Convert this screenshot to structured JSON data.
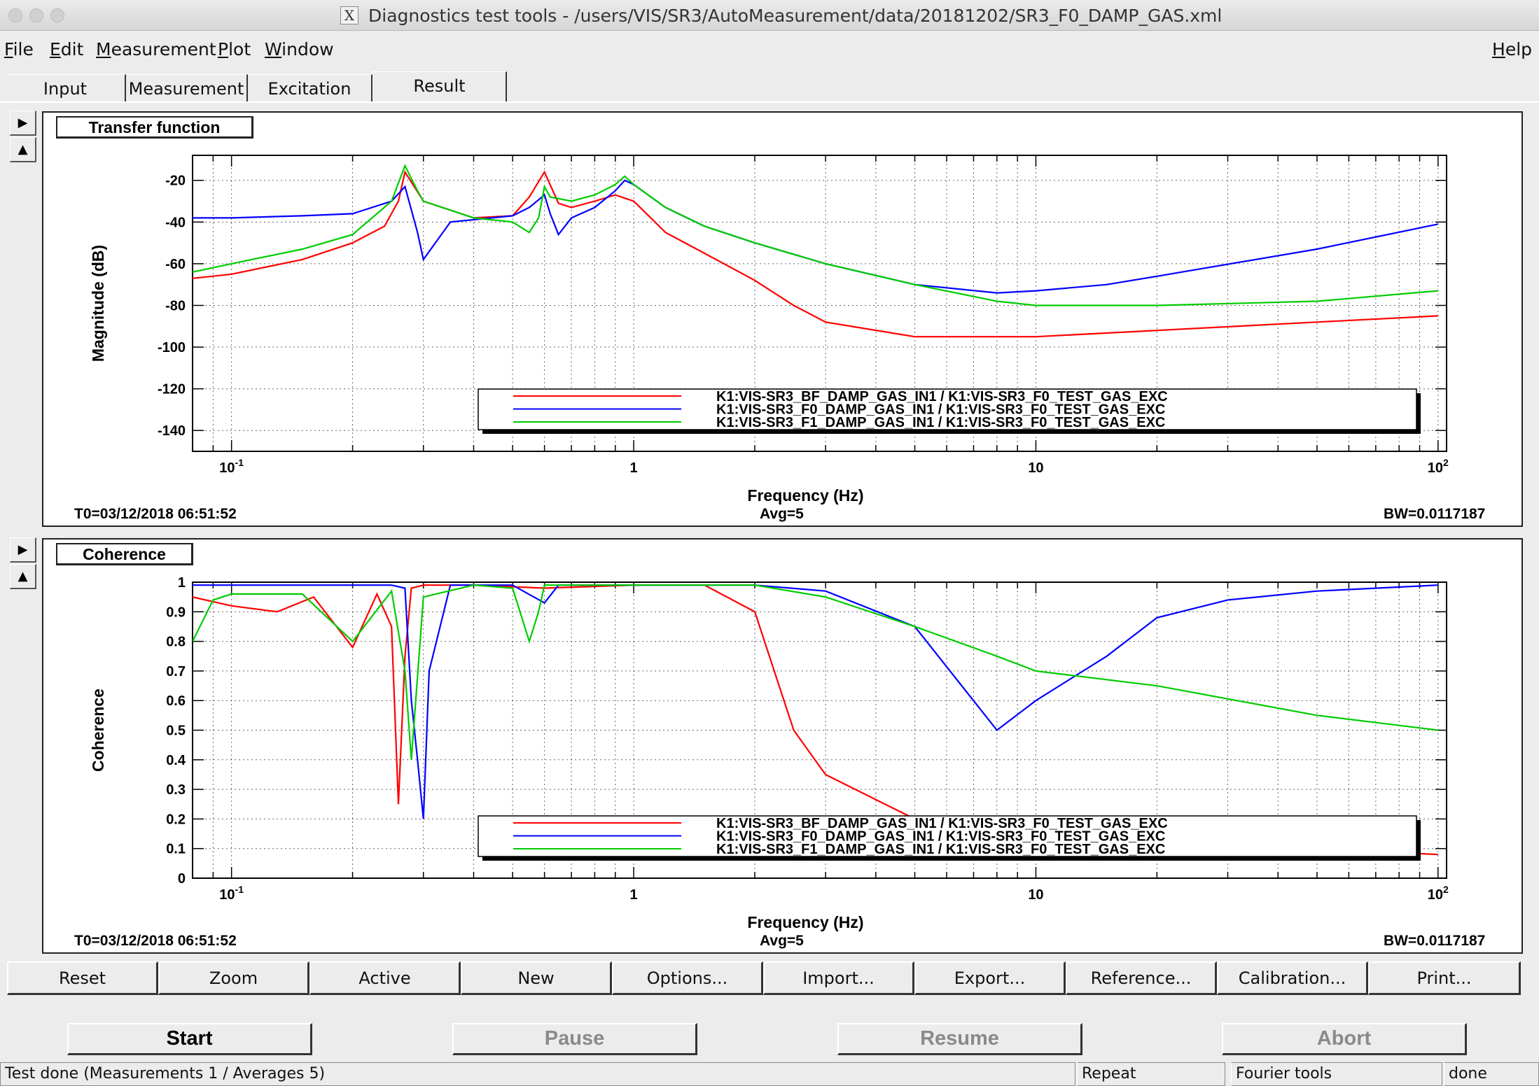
{
  "window": {
    "title": "Diagnostics test tools - /users/VIS/SR3/AutoMeasurement/data/20181202/SR3_F0_DAMP_GAS.xml",
    "title_icon": "x11-icon"
  },
  "menubar": {
    "items": [
      {
        "label": "File",
        "key": "F",
        "rest": "ile"
      },
      {
        "label": "Edit",
        "key": "E",
        "rest": "dit"
      },
      {
        "label": "Measurement",
        "key": "M",
        "rest": "easurement"
      },
      {
        "label": "Plot",
        "key": "P",
        "rest": "lot"
      },
      {
        "label": "Window",
        "key": "W",
        "rest": "indow"
      }
    ],
    "help": {
      "label": "Help",
      "key": "H",
      "rest": "elp"
    }
  },
  "tabs": [
    "Input",
    "Measurement",
    "Excitation",
    "Result"
  ],
  "active_tab": "Result",
  "colors": {
    "red": "#ff0000",
    "blue": "#0000ff",
    "green": "#00cc00"
  },
  "legend": [
    "K1:VIS-SR3_BF_DAMP_GAS_IN1 / K1:VIS-SR3_F0_TEST_GAS_EXC",
    "K1:VIS-SR3_F0_DAMP_GAS_IN1 / K1:VIS-SR3_F0_TEST_GAS_EXC",
    "K1:VIS-SR3_F1_DAMP_GAS_IN1 / K1:VIS-SR3_F0_TEST_GAS_EXC"
  ],
  "chart_data": [
    {
      "type": "line",
      "panel_title": "Transfer function",
      "xlabel": "Frequency (Hz)",
      "ylabel": "Magnitude (dB)",
      "xscale": "log",
      "xlim": [
        0.08,
        105
      ],
      "ylim": [
        -150,
        -8
      ],
      "xticks": [
        "10-1",
        "1",
        "10",
        "102"
      ],
      "yticks": [
        -20,
        -40,
        -60,
        -80,
        -100,
        -120,
        -140
      ],
      "grid": true,
      "legend_position": "bottom-right",
      "t0": "T0=03/12/2018 06:51:52",
      "avg": "Avg=5",
      "bw": "BW=0.0117187",
      "series": [
        {
          "color": "red",
          "x": [
            0.08,
            0.1,
            0.15,
            0.2,
            0.24,
            0.26,
            0.27,
            0.3,
            0.4,
            0.5,
            0.55,
            0.6,
            0.65,
            0.7,
            0.8,
            0.9,
            1.0,
            1.2,
            1.5,
            2,
            2.5,
            3,
            5,
            10,
            20,
            50,
            100
          ],
          "y": [
            -67,
            -65,
            -58,
            -50,
            -42,
            -30,
            -16,
            -30,
            -38,
            -37,
            -28,
            -16,
            -31,
            -33,
            -30,
            -27,
            -30,
            -45,
            -55,
            -68,
            -80,
            -88,
            -95,
            -95,
            -92,
            -88,
            -85
          ]
        },
        {
          "color": "blue",
          "x": [
            0.08,
            0.1,
            0.15,
            0.2,
            0.25,
            0.27,
            0.29,
            0.3,
            0.35,
            0.5,
            0.55,
            0.6,
            0.62,
            0.65,
            0.7,
            0.8,
            0.9,
            0.95,
            1.0,
            1.2,
            1.5,
            2,
            3,
            5,
            8,
            10,
            15,
            20,
            50,
            100
          ],
          "y": [
            -38,
            -38,
            -37,
            -36,
            -30,
            -23,
            -45,
            -58,
            -40,
            -37,
            -33,
            -27,
            -36,
            -46,
            -38,
            -33,
            -25,
            -20,
            -22,
            -33,
            -42,
            -50,
            -60,
            -70,
            -74,
            -73,
            -70,
            -66,
            -53,
            -41
          ]
        },
        {
          "color": "green",
          "x": [
            0.08,
            0.1,
            0.15,
            0.2,
            0.25,
            0.27,
            0.29,
            0.3,
            0.4,
            0.5,
            0.55,
            0.58,
            0.6,
            0.62,
            0.7,
            0.8,
            0.9,
            0.95,
            1.0,
            1.2,
            1.5,
            2,
            3,
            5,
            8,
            10,
            20,
            50,
            100
          ],
          "y": [
            -64,
            -60,
            -53,
            -46,
            -30,
            -13,
            -25,
            -30,
            -38,
            -40,
            -45,
            -38,
            -23,
            -28,
            -30,
            -27,
            -22,
            -18,
            -22,
            -33,
            -42,
            -50,
            -60,
            -70,
            -78,
            -80,
            -80,
            -78,
            -73
          ]
        }
      ]
    },
    {
      "type": "line",
      "panel_title": "Coherence",
      "xlabel": "Frequency (Hz)",
      "ylabel": "Coherence",
      "xscale": "log",
      "xlim": [
        0.08,
        105
      ],
      "ylim": [
        0,
        1
      ],
      "xticks": [
        "10-1",
        "1",
        "10",
        "102"
      ],
      "yticks": [
        1,
        0.9,
        0.8,
        0.7,
        0.6,
        0.5,
        0.4,
        0.3,
        0.2,
        0.1,
        0
      ],
      "grid": true,
      "legend_position": "bottom-right",
      "t0": "T0=03/12/2018 06:51:52",
      "avg": "Avg=5",
      "bw": "BW=0.0117187",
      "series": [
        {
          "color": "red",
          "x": [
            0.08,
            0.1,
            0.13,
            0.16,
            0.2,
            0.23,
            0.25,
            0.26,
            0.27,
            0.28,
            0.3,
            0.4,
            0.6,
            1,
            1.5,
            2,
            2.5,
            3,
            5,
            10,
            20,
            50,
            100
          ],
          "y": [
            0.95,
            0.92,
            0.9,
            0.95,
            0.78,
            0.96,
            0.85,
            0.25,
            0.75,
            0.98,
            0.99,
            0.99,
            0.98,
            0.99,
            0.99,
            0.9,
            0.5,
            0.35,
            0.2,
            0.15,
            0.12,
            0.1,
            0.08
          ]
        },
        {
          "color": "blue",
          "x": [
            0.08,
            0.1,
            0.2,
            0.25,
            0.27,
            0.28,
            0.29,
            0.3,
            0.31,
            0.35,
            0.5,
            0.6,
            0.65,
            0.7,
            1,
            2,
            3,
            5,
            8,
            10,
            15,
            20,
            30,
            50,
            100
          ],
          "y": [
            0.99,
            0.99,
            0.99,
            0.99,
            0.98,
            0.6,
            0.4,
            0.2,
            0.7,
            0.99,
            0.99,
            0.93,
            0.99,
            0.99,
            0.99,
            0.99,
            0.97,
            0.85,
            0.5,
            0.6,
            0.75,
            0.88,
            0.94,
            0.97,
            0.99
          ]
        },
        {
          "color": "green",
          "x": [
            0.08,
            0.09,
            0.1,
            0.15,
            0.2,
            0.25,
            0.27,
            0.28,
            0.3,
            0.4,
            0.5,
            0.55,
            0.58,
            0.6,
            0.7,
            1,
            2,
            3,
            5,
            8,
            10,
            20,
            50,
            100
          ],
          "y": [
            0.8,
            0.94,
            0.96,
            0.96,
            0.8,
            0.97,
            0.7,
            0.4,
            0.95,
            0.99,
            0.98,
            0.8,
            0.9,
            0.99,
            0.99,
            0.99,
            0.99,
            0.95,
            0.85,
            0.75,
            0.7,
            0.65,
            0.55,
            0.5
          ]
        }
      ]
    }
  ],
  "buttons": [
    "Reset",
    "Zoom",
    "Active",
    "New",
    "Options...",
    "Import...",
    "Export...",
    "Reference...",
    "Calibration...",
    "Print..."
  ],
  "controls": [
    {
      "label": "Start",
      "enabled": true
    },
    {
      "label": "Pause",
      "enabled": false
    },
    {
      "label": "Resume",
      "enabled": false
    },
    {
      "label": "Abort",
      "enabled": false
    }
  ],
  "status": {
    "message": "Test done (Measurements 1 / Averages 5)",
    "repeat": "Repeat",
    "tool": "Fourier tools",
    "state": "done"
  }
}
